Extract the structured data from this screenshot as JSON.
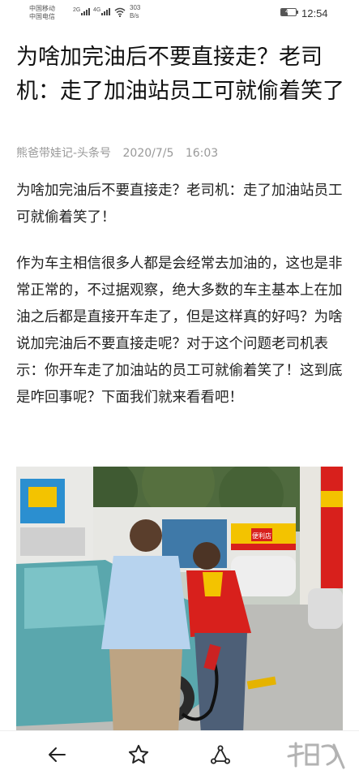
{
  "status": {
    "carrier1": "中国移动",
    "carrier2": "中国电信",
    "sig1_label": "2G",
    "sig2_label": "4G",
    "net_speed_value": "303",
    "net_speed_unit": "B/s",
    "battery": "44",
    "time": "12:54"
  },
  "article": {
    "title": "为啥加完油后不要直接走？老司机：走了加油站员工可就偷着笑了",
    "author": "熊爸带娃记-头条号",
    "date": "2020/7/5",
    "time": "16:03",
    "paragraphs": [
      "为啥加完油后不要直接走？老司机：走了加油站员工可就偷着笑了！",
      "作为车主相信很多人都是会经常去加油的，这也是非常正常的，不过据观察，绝大多数的车主基本上在加油之后都是直接开车走了，但是这样真的好吗？为啥说加完油后不要直接走呢？对于这个问题老司机表示：你开车走了加油站的员工可就偷着笑了！这到底是咋回事呢？下面我们就来看看吧！"
    ],
    "photo_sign_text": "便利店"
  },
  "bottom_bar": {
    "icons": [
      "back-arrow-icon",
      "star-icon",
      "share-icon"
    ]
  },
  "colors": {
    "shell_red": "#d8201c",
    "shell_yellow": "#f3c300",
    "car_teal": "#5aa7ad"
  }
}
